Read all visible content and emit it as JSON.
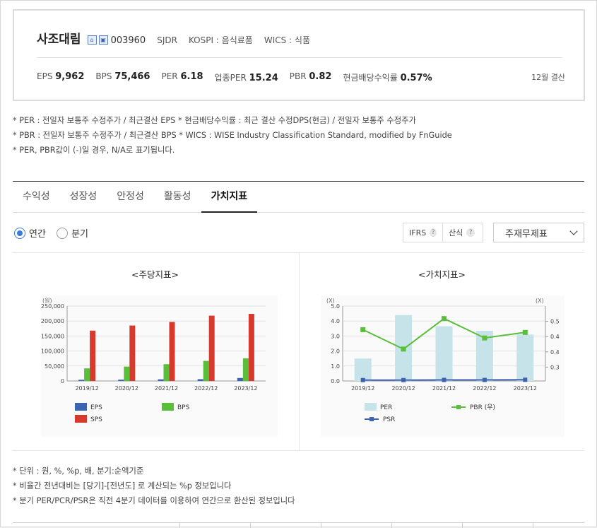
{
  "company": {
    "name": "사조대림",
    "code": "003960",
    "eng": "SJDR",
    "market": "KOSPI : 음식료품",
    "wics": "WICS : 식품",
    "fiscal": "12월 결산",
    "stats": [
      {
        "label": "EPS",
        "value": "9,962"
      },
      {
        "label": "BPS",
        "value": "75,466"
      },
      {
        "label": "PER",
        "value": "6.18"
      },
      {
        "label": "업종PER",
        "value": "15.24"
      },
      {
        "label": "PBR",
        "value": "0.82"
      },
      {
        "label": "현금배당수익률",
        "value": "0.57%"
      }
    ]
  },
  "notes": [
    "* PER : 전일자 보통주 수정주가 / 최근결산 EPS * 현금배당수익률 : 최근 결산 수정DPS(현금) / 전일자 보통주 수정주가",
    "* PBR : 전일자 보통주 수정주가 / 최근결산 BPS * WICS : WISE Industry Classification Standard, modified by FnGuide",
    "* PER, PBR값이 (-)일 경우, N/A로 표기됩니다."
  ],
  "tabs": [
    "수익성",
    "성장성",
    "안정성",
    "활동성",
    "가치지표"
  ],
  "active_tab": "가치지표",
  "period": {
    "annual": "연간",
    "quarter": "분기"
  },
  "buttons": {
    "ifrs": "IFRS",
    "calc": "산식",
    "q": "?"
  },
  "select": {
    "value": "주재무제표"
  },
  "charts": {
    "left_title": "<주당지표>",
    "right_title": "<가치지표>"
  },
  "chart_data": [
    {
      "type": "bar",
      "title": "<주당지표>",
      "unit_label": "(원)",
      "categories": [
        "2019/12",
        "2020/12",
        "2021/12",
        "2022/12",
        "2023/12"
      ],
      "ylim": [
        0,
        250000
      ],
      "yticks": [
        "0",
        "50,000",
        "100,000",
        "150,000",
        "200,000",
        "250,000"
      ],
      "series": [
        {
          "name": "EPS",
          "color": "#3d64b0",
          "values": [
            4000,
            4500,
            5500,
            6000,
            9962
          ]
        },
        {
          "name": "BPS",
          "color": "#59bf3a",
          "values": [
            42000,
            48000,
            56000,
            67000,
            75466
          ]
        },
        {
          "name": "SPS",
          "color": "#d63a2c",
          "values": [
            168000,
            185000,
            197000,
            218000,
            224000
          ]
        }
      ],
      "legend": "bottom"
    },
    {
      "type": "bar",
      "title": "<가치지표>",
      "left_unit": "(X)",
      "right_unit": "(X)",
      "categories": [
        "2019/12",
        "2020/12",
        "2021/12",
        "2022/12",
        "2023/12"
      ],
      "ylim_left": [
        0,
        5
      ],
      "yticks_left": [
        "0.0",
        "1.0",
        "2.0",
        "3.0",
        "4.0",
        "5.0"
      ],
      "ylim_right": [
        0.25,
        0.52
      ],
      "yticks_right": [
        "0.3",
        "0.4",
        "0.4",
        "0.5"
      ],
      "series": [
        {
          "name": "PER",
          "kind": "bar",
          "axis": "left",
          "color": "#c7e3ea",
          "values": [
            1.5,
            4.4,
            3.65,
            3.35,
            3.1
          ]
        },
        {
          "name": "PBR (우)",
          "kind": "line",
          "axis": "right",
          "color": "#59bf3a",
          "values": [
            0.435,
            0.365,
            0.475,
            0.405,
            0.425
          ]
        },
        {
          "name": "PSR",
          "kind": "line",
          "axis": "left",
          "color": "#3d64b0",
          "values": [
            0.06,
            0.06,
            0.07,
            0.07,
            0.08
          ]
        }
      ],
      "legend": "bottom"
    }
  ],
  "footnotes": [
    "* 단위 : 원, %, %p, 배, 분기:순액기준",
    "* 비율간 전년대비는 [당기]-[전년도] 로 계산되는 %p 정보입니다",
    "* 분기 PER/PCR/PSR은 직전 4분기 데이터를 이용하여 연간으로 환산된 정보입니다"
  ]
}
